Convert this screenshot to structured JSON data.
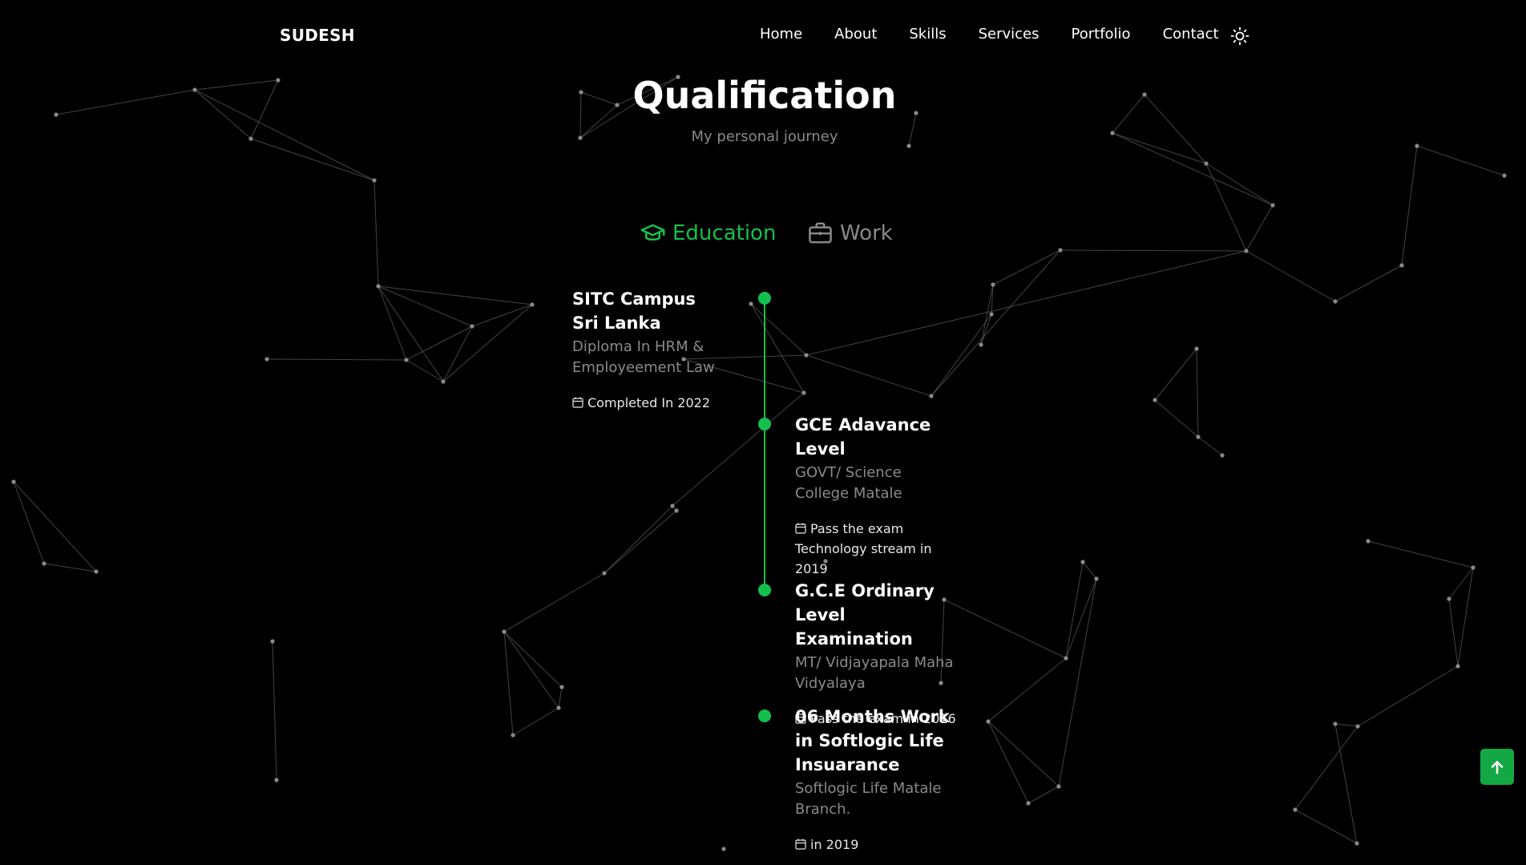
{
  "brand": "SUDESH",
  "nav": {
    "items": [
      "Home",
      "About",
      "Skills",
      "Services",
      "Portfolio",
      "Contact"
    ],
    "theme_icon": "sun-icon"
  },
  "section": {
    "title": "Qualification",
    "subtitle": "My personal journey"
  },
  "tabs": {
    "education": "Education",
    "work": "Work",
    "active": "education",
    "education_icon": "graduation-cap-icon",
    "work_icon": "briefcase-icon"
  },
  "timeline": [
    {
      "title": "SITC Campus Sri Lanka",
      "subtitle": "Diploma In HRM & Employeement Law",
      "date": "Completed In 2022"
    },
    {
      "title": "GCE Adavance Level",
      "subtitle": "GOVT/ Science College Matale",
      "date": "Pass the exam Technology stream in 2019"
    },
    {
      "title": "G.C.E Ordinary Level Examination",
      "subtitle": "MT/ Vidjayapala Maha Vidyalaya",
      "date": "Pass the exam in 2016"
    },
    {
      "title": "06 Months Work in Softlogic Life Insuarance",
      "subtitle": "Softlogic Life Matale Branch.",
      "date": "in 2019"
    }
  ],
  "scroll_up_icon": "arrow-up-icon",
  "colors": {
    "accent": "#14c04d",
    "background": "#000000",
    "muted_text": "#8a8a8a"
  }
}
